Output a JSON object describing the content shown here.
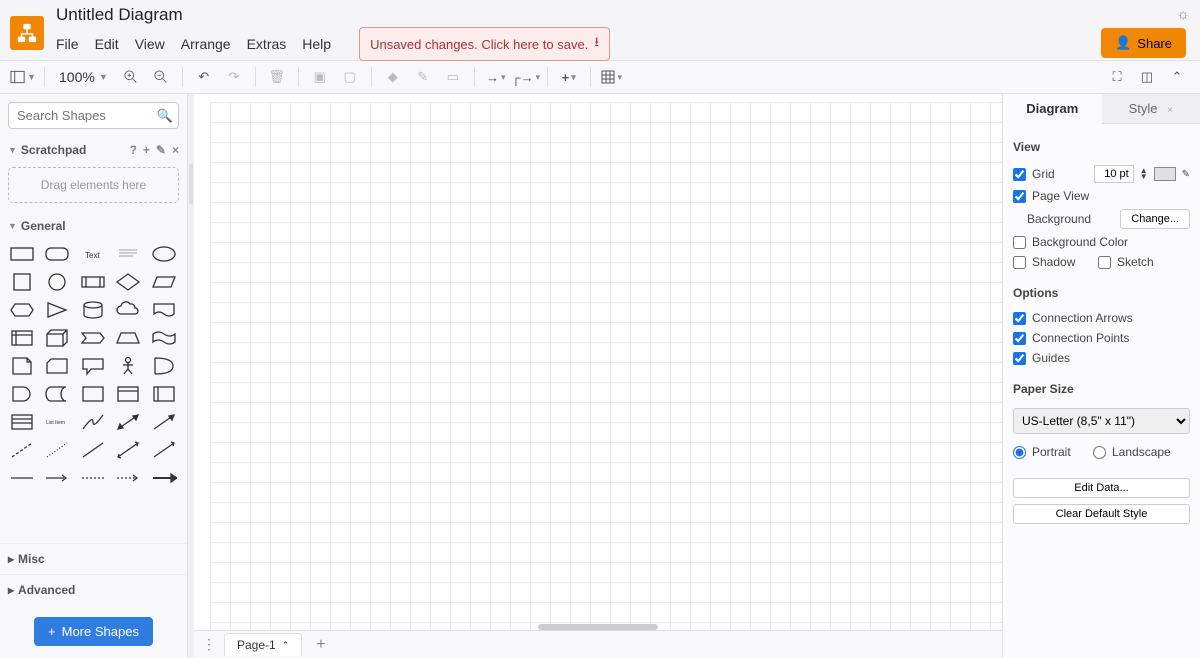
{
  "header": {
    "title": "Untitled Diagram",
    "menus": [
      "File",
      "Edit",
      "View",
      "Arrange",
      "Extras",
      "Help"
    ],
    "unsaved_label": "Unsaved changes. Click here to save.",
    "share_label": "Share"
  },
  "toolbar": {
    "zoom": "100%"
  },
  "sidebar": {
    "search_placeholder": "Search Shapes",
    "scratchpad_label": "Scratchpad",
    "scratchpad_drop_hint": "Drag elements here",
    "general_label": "General",
    "misc_label": "Misc",
    "advanced_label": "Advanced",
    "more_shapes_label": "More Shapes"
  },
  "pages": {
    "tab1": "Page-1"
  },
  "right_panel": {
    "tab_diagram": "Diagram",
    "tab_style": "Style",
    "view_title": "View",
    "grid_label": "Grid",
    "grid_value": "10 pt",
    "pageview_label": "Page View",
    "background_label": "Background",
    "change_label": "Change...",
    "bgcolor_label": "Background Color",
    "shadow_label": "Shadow",
    "sketch_label": "Sketch",
    "options_title": "Options",
    "conn_arrows_label": "Connection Arrows",
    "conn_points_label": "Connection Points",
    "guides_label": "Guides",
    "paper_title": "Paper Size",
    "paper_value": "US-Letter (8,5\" x 11\")",
    "portrait_label": "Portrait",
    "landscape_label": "Landscape",
    "edit_data_label": "Edit Data...",
    "clear_style_label": "Clear Default Style"
  }
}
